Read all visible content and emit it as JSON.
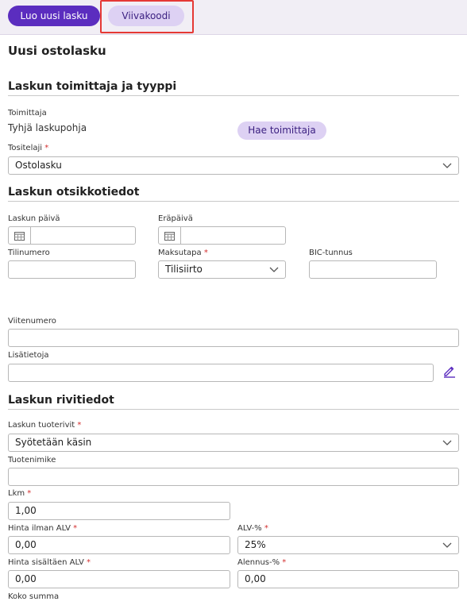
{
  "toolbar": {
    "create_invoice": "Luo uusi lasku",
    "barcode": "Viivakoodi"
  },
  "page_title": "Uusi ostolasku",
  "sections": {
    "supplier": "Laskun toimittaja ja tyyppi",
    "header": "Laskun otsikkotiedot",
    "rows": "Laskun rivitiedot"
  },
  "supplier": {
    "label": "Toimittaja",
    "value": "Tyhjä laskupohja",
    "search_button": "Hae toimittaja"
  },
  "voucher_type": {
    "label": "Tositelaji",
    "value": "Ostolasku"
  },
  "invoice_date": {
    "label": "Laskun päivä",
    "value": ""
  },
  "due_date": {
    "label": "Eräpäivä",
    "value": ""
  },
  "account_number": {
    "label": "Tilinumero",
    "value": ""
  },
  "payment_method": {
    "label": "Maksutapa",
    "value": "Tilisiirto"
  },
  "bic": {
    "label": "BIC-tunnus",
    "value": ""
  },
  "reference": {
    "label": "Viitenumero",
    "value": ""
  },
  "additional_info": {
    "label": "Lisätietoja",
    "value": ""
  },
  "product_rows": {
    "label": "Laskun tuoterivit",
    "value": "Syötetään käsin"
  },
  "product_name": {
    "label": "Tuotenimike",
    "value": ""
  },
  "quantity": {
    "label": "Lkm",
    "value": "1,00"
  },
  "price_excl_vat": {
    "label": "Hinta ilman ALV",
    "value": "0,00"
  },
  "vat_percent": {
    "label": "ALV-%",
    "value": "25%"
  },
  "price_incl_vat": {
    "label": "Hinta sisältäen ALV",
    "value": "0,00"
  },
  "discount_percent": {
    "label": "Alennus-%",
    "value": "0,00"
  },
  "total_label": "Koko summa",
  "colors": {
    "accent": "#5b2dbf",
    "accent_light": "#ddd1f3",
    "required": "#d32f2f",
    "highlight": "#e53935"
  }
}
